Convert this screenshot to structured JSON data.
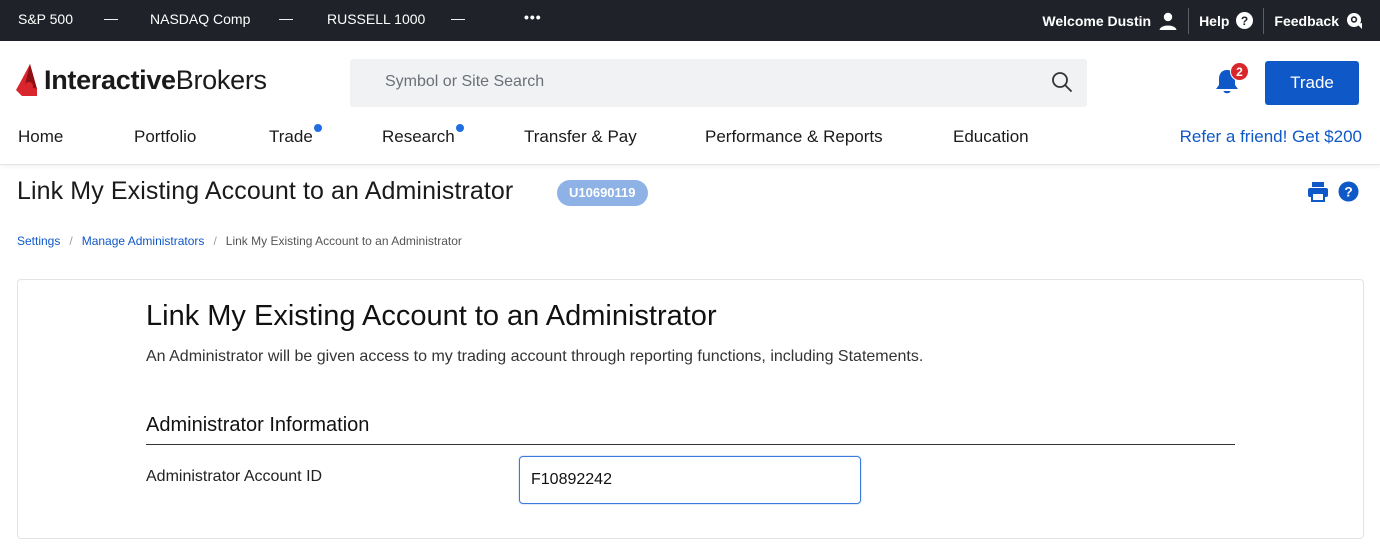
{
  "ticker": {
    "items": [
      "S&P 500",
      "NASDAQ Comp",
      "RUSSELL 1000"
    ],
    "dash": "—",
    "more": "•••",
    "welcome": "Welcome Dustin",
    "help": "Help",
    "feedback": "Feedback"
  },
  "header": {
    "logo_light": "Interactive",
    "logo_bold": "Brokers",
    "search_placeholder": "Symbol or Site Search",
    "notification_count": "2",
    "trade_button": "Trade",
    "nav": [
      "Home",
      "Portfolio",
      "Trade",
      "Research",
      "Transfer & Pay",
      "Performance & Reports",
      "Education"
    ],
    "refer": "Refer a friend! Get $200"
  },
  "page": {
    "title": "Link My Existing Account to an Administrator",
    "account_id": "U10690119"
  },
  "breadcrumb": {
    "settings": "Settings",
    "manage": "Manage Administrators",
    "current": "Link My Existing Account to an Administrator",
    "separator": "/"
  },
  "form": {
    "heading": "Link My Existing Account to an Administrator",
    "description": "An Administrator will be given access to my trading account through reporting functions, including Statements.",
    "section": "Administrator Information",
    "field_label": "Administrator Account ID",
    "field_value": "F10892242"
  },
  "colors": {
    "ticker_bg": "#1f2329",
    "brand_red": "#d9262c",
    "brand_blue": "#0f58c7",
    "pill": "#8fb2e6"
  }
}
